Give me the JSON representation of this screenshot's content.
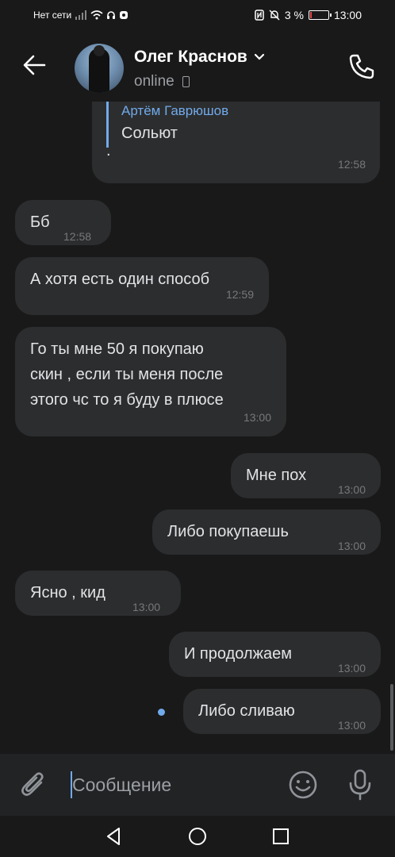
{
  "status_bar": {
    "network_text": "Нет сети",
    "battery_percent": "3 %",
    "battery_level": 0.03,
    "time": "13:00"
  },
  "header": {
    "contact_name": "Олег Краснов",
    "status": "online"
  },
  "messages": [
    {
      "id": "m0",
      "direction": "outgoing",
      "quote_author": "Артём Гаврюшов",
      "quote_text": "Сольют",
      "text": ".",
      "time": "12:58"
    },
    {
      "id": "m1",
      "direction": "incoming",
      "text": "Бб",
      "time": "12:58"
    },
    {
      "id": "m2",
      "direction": "incoming",
      "text": "А хотя есть один способ",
      "time": "12:59"
    },
    {
      "id": "m3",
      "direction": "incoming",
      "lines": [
        "Го ты мне 50 я покупаю",
        "скин , если ты меня после",
        "этого чс то я буду в плюсе"
      ],
      "time": "13:00"
    },
    {
      "id": "m4",
      "direction": "outgoing",
      "text": "Мне пох",
      "time": "13:00"
    },
    {
      "id": "m5",
      "direction": "outgoing",
      "text": "Либо покупаешь",
      "time": "13:00"
    },
    {
      "id": "m6",
      "direction": "incoming",
      "text": "Ясно , кид",
      "time": "13:00"
    },
    {
      "id": "m7",
      "direction": "outgoing",
      "text": "И продолжаем",
      "time": "13:00"
    },
    {
      "id": "m8",
      "direction": "outgoing",
      "text": "Либо сливаю",
      "time": "13:00",
      "unread": true
    }
  ],
  "input": {
    "placeholder": "Сообщение",
    "value": ""
  },
  "colors": {
    "background": "#19191a",
    "bubble": "#2c2d2e",
    "accent": "#71aaeb",
    "time": "#76787a"
  },
  "icons": [
    "back-arrow-icon",
    "chevron-down-icon",
    "mobile-phone-icon",
    "phone-call-icon",
    "paperclip-icon",
    "emoji-icon",
    "microphone-icon",
    "nav-back-icon",
    "nav-home-icon",
    "nav-recents-icon"
  ]
}
